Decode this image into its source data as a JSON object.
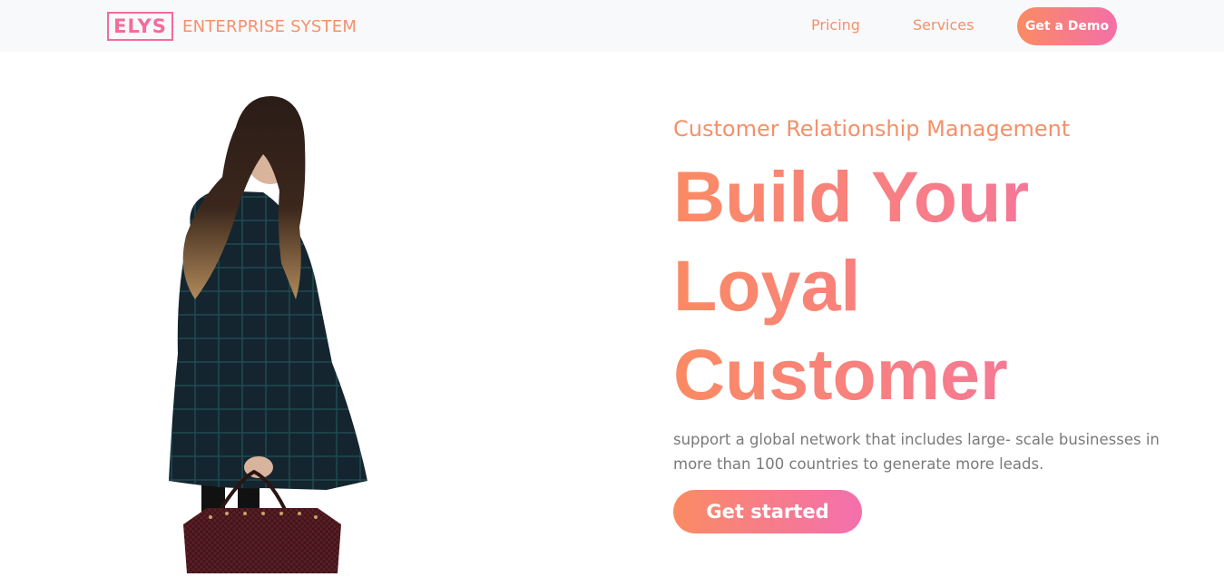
{
  "header": {
    "brand_logo": "ELYS",
    "brand_name": "ENTERPRISE SYSTEM",
    "nav": {
      "pricing": "Pricing",
      "services": "Services"
    },
    "cta_label": "Get a Demo"
  },
  "hero": {
    "subtitle": "Customer Relationship Management",
    "headline_lines": [
      "Build Your",
      "Loyal",
      "Customer"
    ],
    "description": "support a global network that includes large- scale businesses in more than 100 countries to generate more leads.",
    "button_label": "Get started",
    "image_alt": "woman-with-handbag-photo"
  },
  "colors": {
    "accent_orange": "#fa8b63",
    "accent_pink": "#f46fae",
    "nav_text": "#f5906a",
    "body_text": "#7a7a7a",
    "header_bg": "#f8f9fa"
  }
}
